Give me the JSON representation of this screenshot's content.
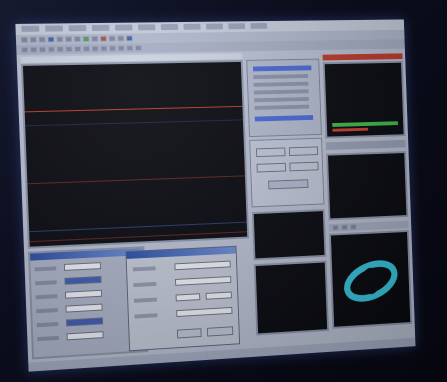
{
  "app": {
    "title": ""
  },
  "menu": {
    "items": [
      "",
      "",
      "",
      "",
      "",
      "",
      "",
      "",
      "",
      "",
      ""
    ]
  },
  "colors": {
    "trace_main": "#c03a2a",
    "trace_secondary": "#4a6ad8",
    "spectrum_green": "#3fbf4a",
    "spectrum_red": "#d04030",
    "ring_cyan": "#38c8e0",
    "window_title_blue": "#2a4fa8"
  },
  "icons": [
    "window-icon",
    "play-icon",
    "stop-icon",
    "record-icon",
    "zoom-icon",
    "settings-icon"
  ]
}
